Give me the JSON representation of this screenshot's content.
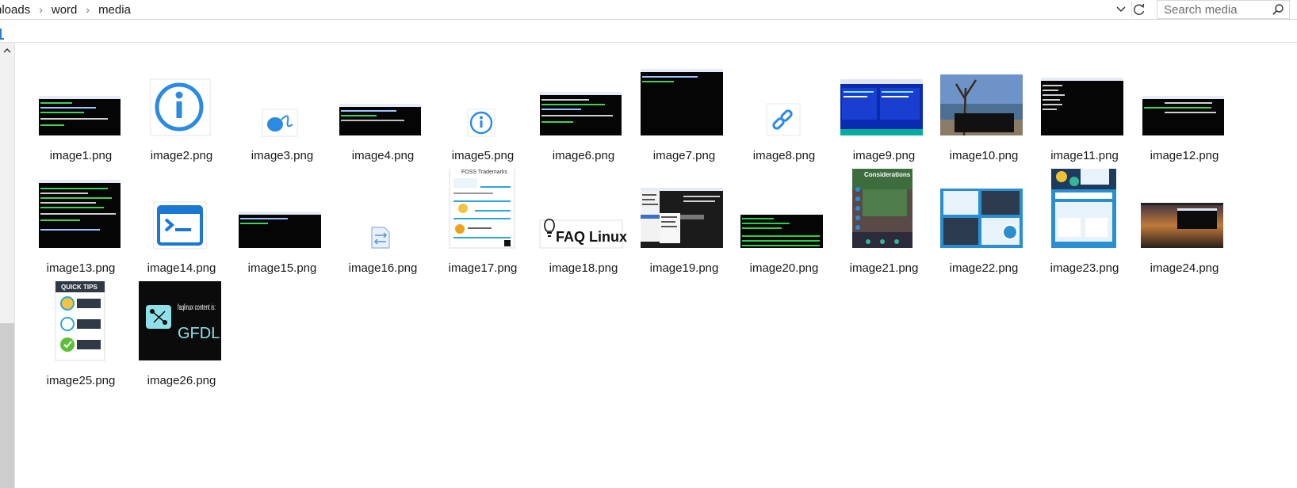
{
  "breadcrumb": {
    "items": [
      "nloads",
      "word",
      "media"
    ],
    "separator": "›"
  },
  "search": {
    "placeholder": "Search media"
  },
  "colors": {
    "accent": "#2c7bd6",
    "icon_blue": "#2b8ae2",
    "terminal_bg": "#050505",
    "terminal_green": "#2ad04a"
  },
  "files": [
    {
      "name": "image1.png",
      "thumb": "terminal-screenshot"
    },
    {
      "name": "image2.png",
      "thumb": "info-icon-large"
    },
    {
      "name": "image3.png",
      "thumb": "mouse-icon"
    },
    {
      "name": "image4.png",
      "thumb": "terminal-screenshot"
    },
    {
      "name": "image5.png",
      "thumb": "info-icon-small"
    },
    {
      "name": "image6.png",
      "thumb": "terminal-screenshot"
    },
    {
      "name": "image7.png",
      "thumb": "terminal-screenshot"
    },
    {
      "name": "image8.png",
      "thumb": "link-icon"
    },
    {
      "name": "image9.png",
      "thumb": "blue-file-manager-screenshot"
    },
    {
      "name": "image10.png",
      "thumb": "desktop-photo"
    },
    {
      "name": "image11.png",
      "thumb": "terminal-screenshot"
    },
    {
      "name": "image12.png",
      "thumb": "terminal-screenshot"
    },
    {
      "name": "image13.png",
      "thumb": "terminal-screenshot"
    },
    {
      "name": "image14.png",
      "thumb": "powershell-icon"
    },
    {
      "name": "image15.png",
      "thumb": "terminal-screenshot"
    },
    {
      "name": "image16.png",
      "thumb": "file-icon"
    },
    {
      "name": "image17.png",
      "thumb": "infographic"
    },
    {
      "name": "image18.png",
      "thumb": "faq-linux-logo"
    },
    {
      "name": "image19.png",
      "thumb": "menu-screenshot"
    },
    {
      "name": "image20.png",
      "thumb": "green-terminal-screenshot"
    },
    {
      "name": "image21.png",
      "thumb": "poster"
    },
    {
      "name": "image22.png",
      "thumb": "infographic-blue"
    },
    {
      "name": "image23.png",
      "thumb": "infographic-blue"
    },
    {
      "name": "image24.png",
      "thumb": "sunset-desktop-photo"
    },
    {
      "name": "image25.png",
      "thumb": "quick-tips-poster"
    },
    {
      "name": "image26.png",
      "thumb": "gfdl-badge"
    }
  ],
  "thumb_text": {
    "faq_logo": "FAQ Linux",
    "quick_tips": "QUICK TIPS",
    "gfdl_small": "faqlinux content is:",
    "gfdl_big": "GFDL",
    "infographic_title": "FOSS Trademarks",
    "poster_title": "Considerations"
  }
}
